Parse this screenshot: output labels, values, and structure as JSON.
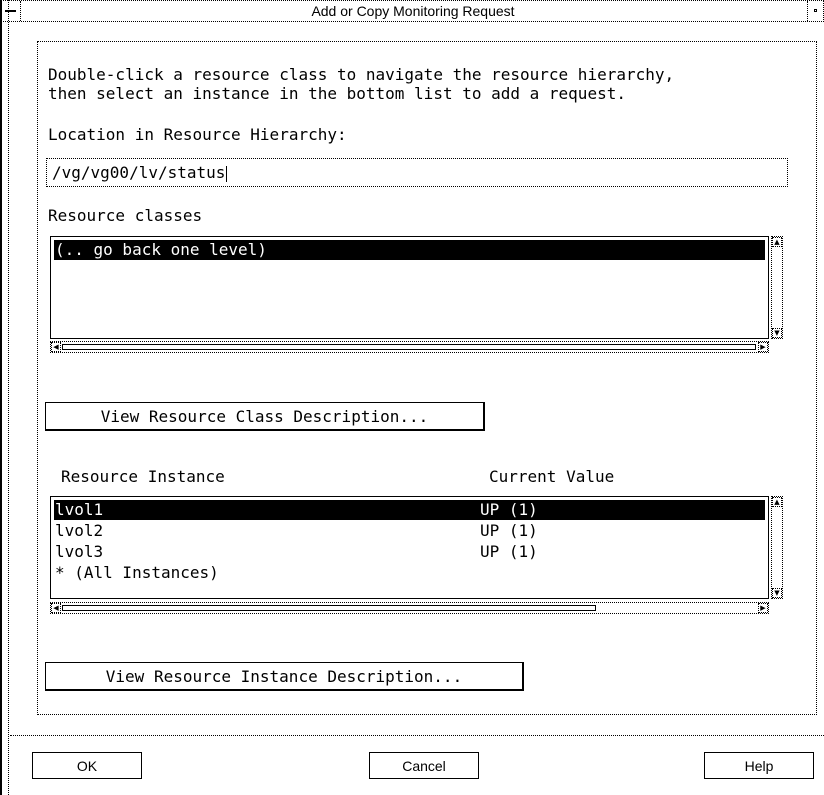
{
  "window": {
    "title": "Add or Copy Monitoring Request"
  },
  "instructions": {
    "line1": "Double-click a resource class to navigate the resource hierarchy,",
    "line2": "then select an instance in the bottom list to add a request."
  },
  "location": {
    "label": "Location in Resource Hierarchy:",
    "value": "/vg/vg00/lv/status"
  },
  "resource_classes": {
    "label": "Resource classes",
    "items": [
      "(.. go back one level)"
    ],
    "selected_index": 0
  },
  "view_class_button": {
    "label": "View Resource Class Description..."
  },
  "instances": {
    "col_instance": "Resource Instance",
    "col_value": "Current Value",
    "rows": [
      {
        "instance": "lvol1",
        "value": "UP (1)"
      },
      {
        "instance": "lvol2",
        "value": "UP (1)"
      },
      {
        "instance": "lvol3",
        "value": "UP (1)"
      },
      {
        "instance": "* (All Instances)",
        "value": ""
      }
    ],
    "selected_index": 0,
    "hscroll_fraction": 0.77
  },
  "view_instance_button": {
    "label": "View Resource Instance Description..."
  },
  "footer": {
    "ok_label": "OK",
    "cancel_label": "Cancel",
    "help_label": "Help"
  },
  "icons": {
    "window_menu": "window-menu-icon",
    "minimize": "minimize-icon"
  }
}
